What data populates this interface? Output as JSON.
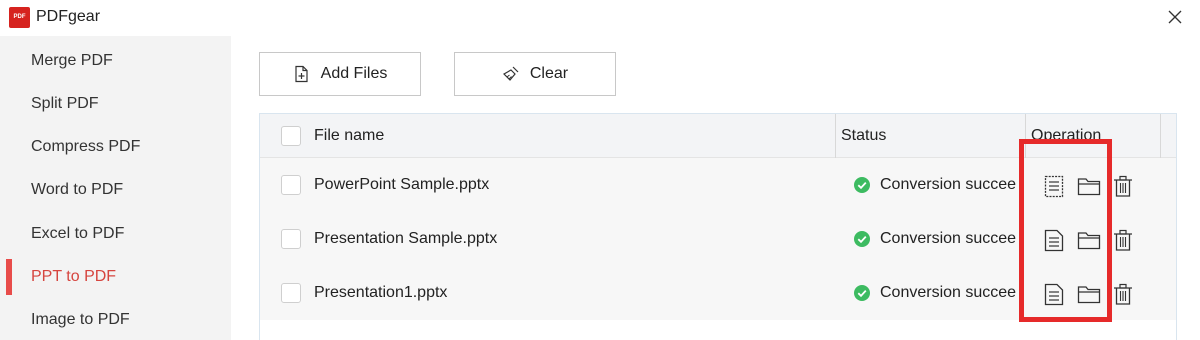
{
  "app": {
    "title": "PDFgear",
    "logo_text": "PDF",
    "close_icon": "close-icon"
  },
  "sidebar": {
    "items": [
      {
        "label": "Merge PDF",
        "active": false
      },
      {
        "label": "Split PDF",
        "active": false
      },
      {
        "label": "Compress PDF",
        "active": false
      },
      {
        "label": "Word to PDF",
        "active": false
      },
      {
        "label": "Excel to PDF",
        "active": false
      },
      {
        "label": "PPT to PDF",
        "active": true
      },
      {
        "label": "Image to PDF",
        "active": false
      }
    ],
    "active_color": "#e84c4a"
  },
  "toolbar": {
    "add_files_label": "Add Files",
    "add_files_icon": "add-file-icon",
    "clear_label": "Clear",
    "clear_icon": "broom-icon"
  },
  "table": {
    "columns": [
      "File name",
      "Status",
      "Operation"
    ],
    "rows": [
      {
        "file_name": "PowerPoint Sample.pptx",
        "status": "Conversion succee"
      },
      {
        "file_name": "Presentation Sample.pptx",
        "status": "Conversion succee"
      },
      {
        "file_name": "Presentation1.pptx",
        "status": "Conversion succee"
      }
    ],
    "operation_icons": [
      "document-icon",
      "folder-icon",
      "trash-icon"
    ],
    "status_color": "#3dbb61"
  },
  "annotation": {
    "highlight_color": "#e62a2a"
  }
}
